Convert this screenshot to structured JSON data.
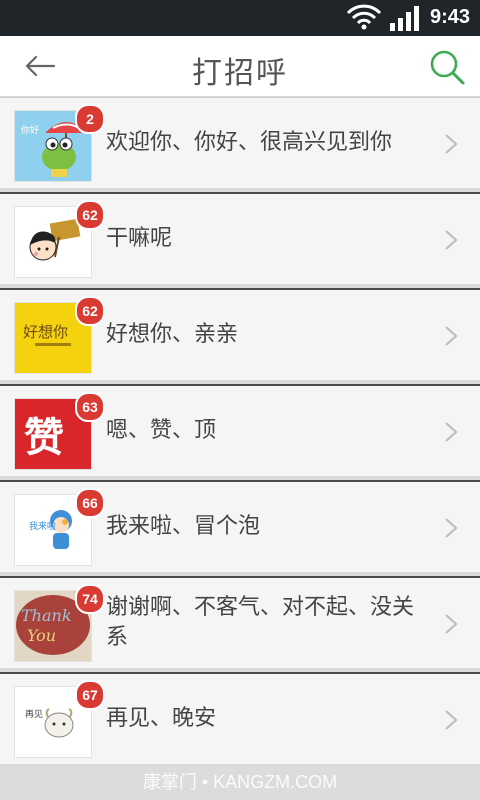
{
  "statusbar": {
    "time": "9:43"
  },
  "header": {
    "title": "打招呼"
  },
  "items": [
    {
      "label": "欢迎你、你好、很高兴见到你",
      "count": "2",
      "thumb": "frog-umbrella-sticker"
    },
    {
      "label": "干嘛呢",
      "count": "62",
      "thumb": "cartoon-kid-sign-sticker"
    },
    {
      "label": "好想你、亲亲",
      "count": "62",
      "thumb": "miss-you-text-sticker"
    },
    {
      "label": "嗯、赞、顶",
      "count": "63",
      "thumb": "zan-character-sticker"
    },
    {
      "label": "我来啦、冒个泡",
      "count": "66",
      "thumb": "blue-character-sticker"
    },
    {
      "label": "谢谢啊、不客气、对不起、没关系",
      "count": "74",
      "thumb": "thank-you-sticker"
    },
    {
      "label": "再见、晚安",
      "count": "67",
      "thumb": "sheep-goodbye-sticker"
    }
  ],
  "watermark": "康掌门 • KANGZM.COM",
  "colors": {
    "accent_green": "#3daa4f",
    "badge_red": "#d93a32"
  }
}
